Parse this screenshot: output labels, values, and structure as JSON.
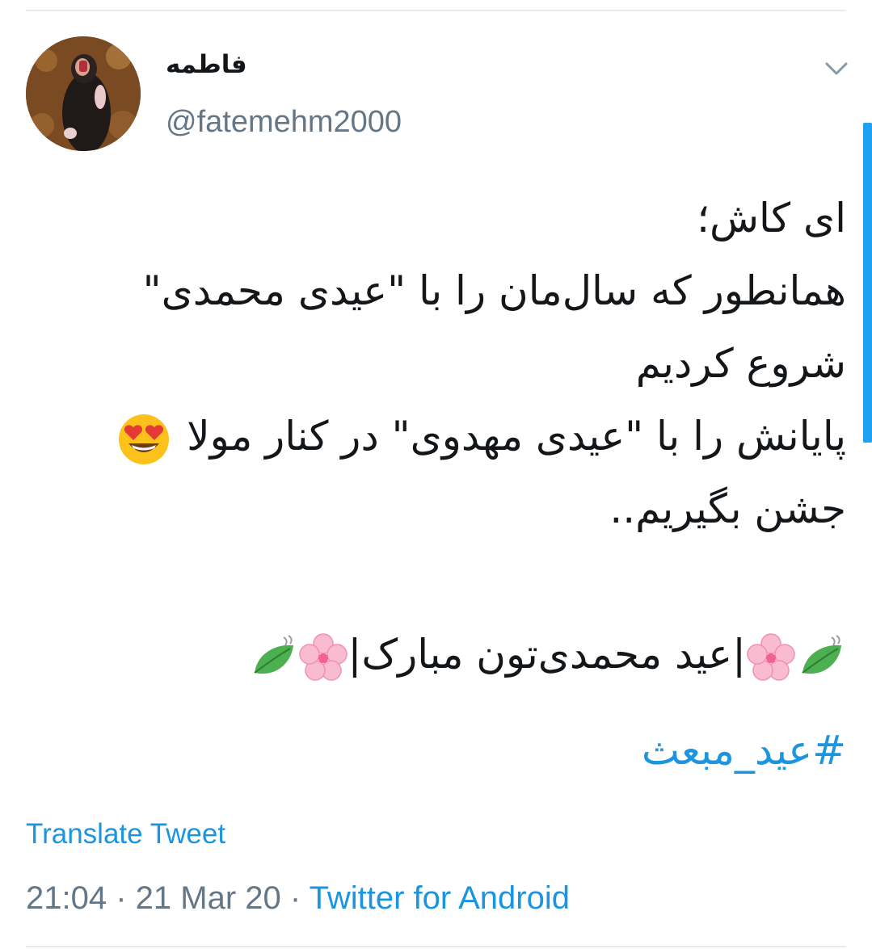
{
  "user": {
    "display_name": "فاطمه",
    "handle": "@fatemehm2000"
  },
  "tweet": {
    "lines": [
      "ای کاش؛",
      " همانطور که سال‌مان را با \"عیدی محمدی\"",
      "شروع کردیم",
      "پایانش را با \"عیدی مهدوی\" در کنار مولا",
      "جشن بگیریم.."
    ],
    "closing_text": "|عید محمدی‌تون مبارک|",
    "hashtag": "#عید_مبعث"
  },
  "translate_label": "Translate Tweet",
  "meta": {
    "time": "21:04",
    "separator": " · ",
    "date": "21 Mar 20",
    "source": "Twitter for Android"
  },
  "icons": {
    "menu": "chevron-down-icon",
    "heart_eyes": "smiling-face-heart-eyes-emoji",
    "leaf": "leaf-fluttering-emoji",
    "blossom": "cherry-blossom-emoji"
  },
  "colors": {
    "link": "#1b95e0",
    "secondary_text": "#657786",
    "primary_text": "#14171a",
    "scrollbar": "#1da1f2"
  }
}
